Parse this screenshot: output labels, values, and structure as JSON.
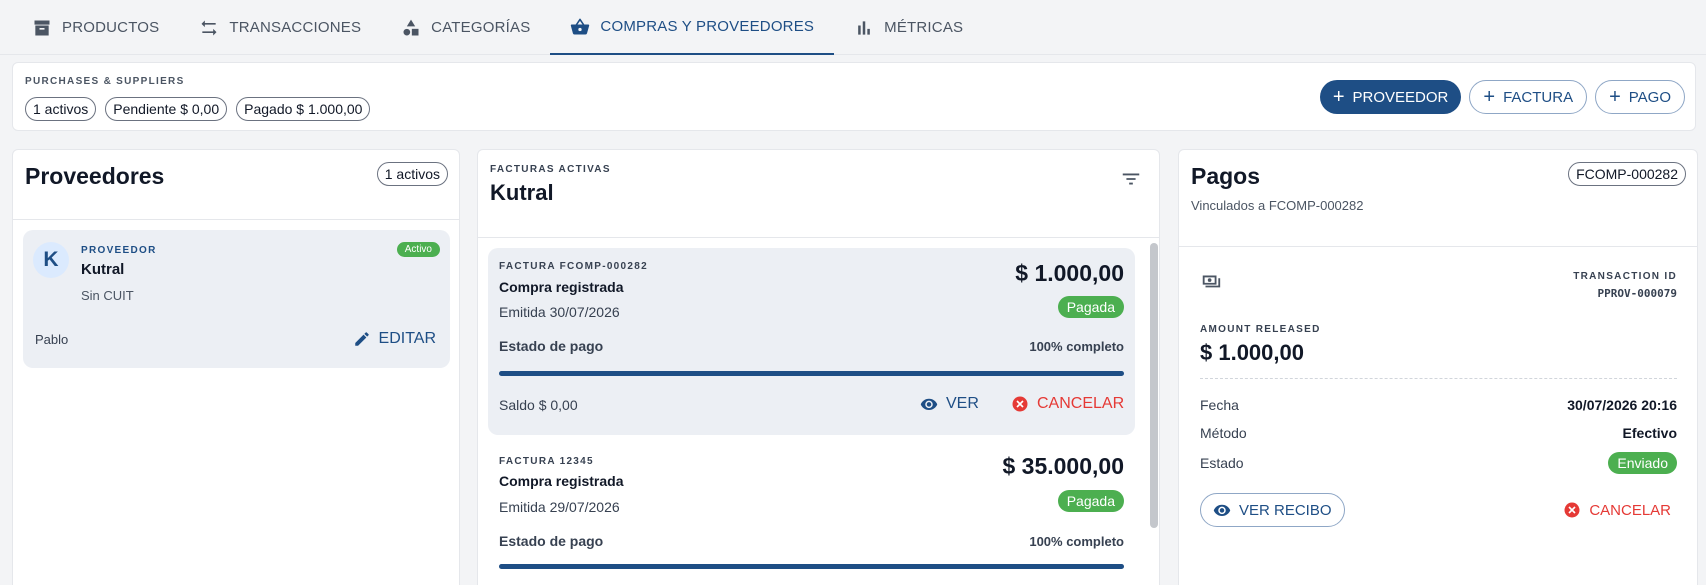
{
  "nav": {
    "tabs": [
      {
        "label": "PRODUCTOS",
        "icon": "archive-icon"
      },
      {
        "label": "TRANSACCIONES",
        "icon": "swap-icon"
      },
      {
        "label": "CATEGORÍAS",
        "icon": "shapes-icon"
      },
      {
        "label": "COMPRAS Y PROVEEDORES",
        "icon": "basket-icon",
        "active": true
      },
      {
        "label": "MÉTRICAS",
        "icon": "bar-chart-icon"
      }
    ]
  },
  "summary": {
    "title": "PURCHASES & SUPPLIERS",
    "chips": [
      "1 activos",
      "Pendiente $ 0,00",
      "Pagado $ 1.000,00"
    ],
    "buttons": {
      "proveedor": "PROVEEDOR",
      "factura": "FACTURA",
      "pago": "PAGO"
    }
  },
  "suppliers": {
    "title": "Proveedores",
    "badge": "1 activos",
    "card": {
      "initial": "K",
      "caption": "PROVEEDOR",
      "name": "Kutral",
      "cuit": "Sin CUIT",
      "status": "Activo",
      "contact": "Pablo",
      "edit_label": "EDITAR"
    }
  },
  "invoices": {
    "caption": "FACTURAS ACTIVAS",
    "title": "Kutral",
    "items": [
      {
        "label": "FACTURA FCOMP-000282",
        "desc": "Compra registrada",
        "date": "Emitida 30/07/2026",
        "amount": "$ 1.000,00",
        "status": "Pagada",
        "progress_label": "Estado de pago",
        "progress_text": "100% completo",
        "progress": 1.0,
        "balance": "Saldo $ 0,00",
        "view_label": "VER",
        "cancel_label": "CANCELAR"
      },
      {
        "label": "FACTURA 12345",
        "desc": "Compra registrada",
        "date": "Emitida 29/07/2026",
        "amount": "$ 35.000,00",
        "status": "Pagada",
        "progress_label": "Estado de pago",
        "progress_text": "100% completo",
        "progress": 1.0
      }
    ]
  },
  "payments": {
    "title": "Pagos",
    "badge": "FCOMP-000282",
    "subtitle": "Vinculados a FCOMP-000282",
    "transaction_caption": "TRANSACTION ID",
    "transaction_id": "PPROV-000079",
    "amount_caption": "AMOUNT RELEASED",
    "amount": "$ 1.000,00",
    "fields": {
      "fecha_label": "Fecha",
      "fecha": "30/07/2026 20:16",
      "metodo_label": "Método",
      "metodo": "Efectivo",
      "estado_label": "Estado",
      "estado": "Enviado"
    },
    "receipt_label": "VER RECIBO",
    "cancel_label": "CANCELAR"
  },
  "colors": {
    "primary": "#1e4e85",
    "success": "#4caf50",
    "danger": "#e53935"
  }
}
